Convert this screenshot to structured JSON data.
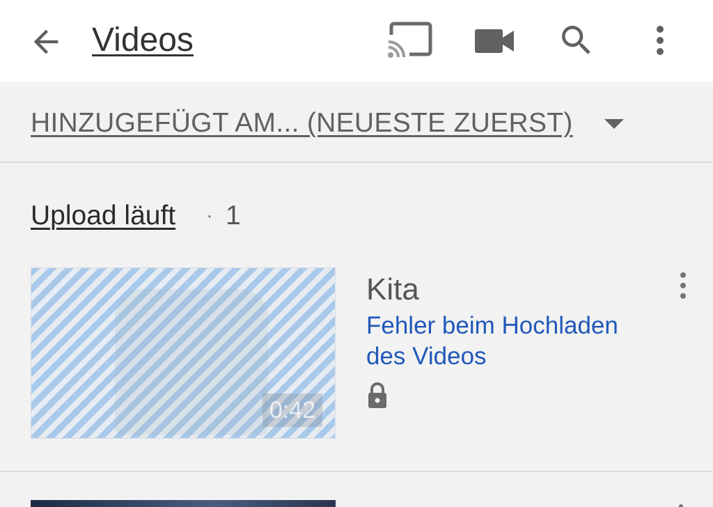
{
  "appbar": {
    "title": "Videos",
    "icons": {
      "back": "arrow-left-icon",
      "cast": "cast-icon",
      "camera": "video-camera-icon",
      "search": "search-icon",
      "more": "more-vert-icon"
    }
  },
  "sort": {
    "label": "HINZUGEFÜGT AM... (NEUESTE ZUERST)",
    "icon": "dropdown-caret-icon"
  },
  "section": {
    "title": "Upload läuft",
    "separator": "·",
    "count": "1"
  },
  "videos": [
    {
      "title": "Kita",
      "status": "Fehler beim Hochladen des Videos",
      "duration": "0:42",
      "privacy_icon": "lock-icon"
    }
  ],
  "colors": {
    "background": "#f2f2f2",
    "appbar": "#ffffff",
    "error_text": "#1f58b9",
    "thumbnail_stripe": "#a9c9ea"
  }
}
